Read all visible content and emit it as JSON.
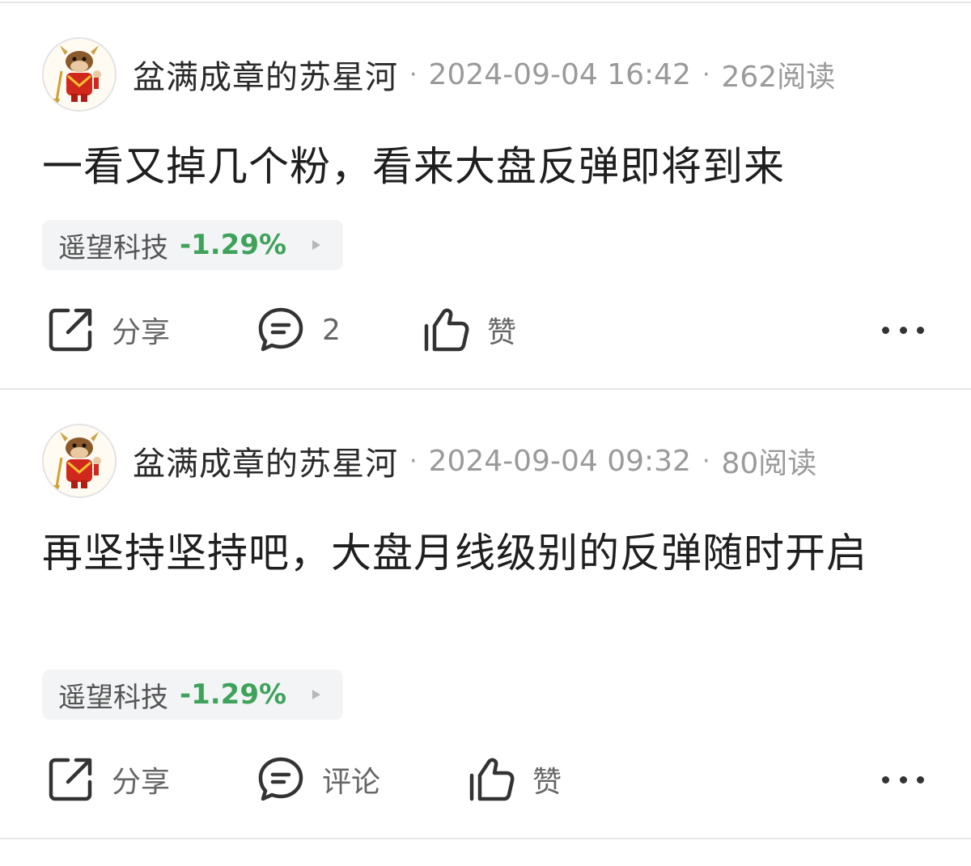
{
  "colors": {
    "background": "#ffffff",
    "divider": "#e6e6e6",
    "meta_text": "#9a9a9a",
    "tag_background": "#f3f4f6",
    "stock_down_green": "#3fa25b",
    "icon": "#333333"
  },
  "posts": [
    {
      "avatar_icon": "bull-mascot-avatar",
      "author": "盆满成章的苏星河",
      "separator": "·",
      "time": "2024-09-04 16:42",
      "reads": "262阅读",
      "text": "一看又掉几个粉，看来大盘反弹即将到来",
      "stock": {
        "name": "遥望科技",
        "change": "-1.29%",
        "arrow_icon": "triangle-right-icon"
      },
      "actions": {
        "share": {
          "icon": "share-icon",
          "label": "分享"
        },
        "comment": {
          "icon": "comment-icon",
          "label": "2"
        },
        "like": {
          "icon": "thumbs-up-icon",
          "label": "赞"
        },
        "more_icon": "more-dots-icon"
      }
    },
    {
      "avatar_icon": "bull-mascot-avatar",
      "author": "盆满成章的苏星河",
      "separator": "·",
      "time": "2024-09-04 09:32",
      "reads": "80阅读",
      "text": "再坚持坚持吧，大盘月线级别的反弹随时开启",
      "stock": {
        "name": "遥望科技",
        "change": "-1.29%",
        "arrow_icon": "triangle-right-icon"
      },
      "actions": {
        "share": {
          "icon": "share-icon",
          "label": "分享"
        },
        "comment": {
          "icon": "comment-icon",
          "label": "评论"
        },
        "like": {
          "icon": "thumbs-up-icon",
          "label": "赞"
        },
        "more_icon": "more-dots-icon"
      }
    }
  ]
}
